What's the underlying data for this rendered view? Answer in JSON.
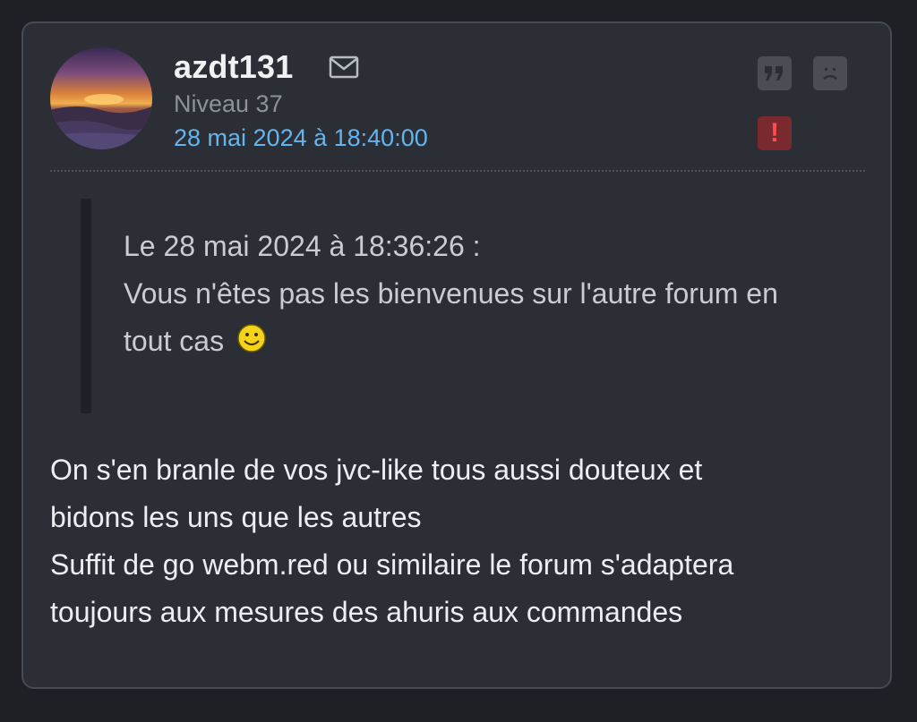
{
  "post": {
    "author": {
      "username": "azdt131",
      "level": "Niveau 37",
      "avatar_icon": "sunset-avatar"
    },
    "date": "28 mai 2024 à 18:40:00",
    "actions": {
      "quote_icon": "quote-icon",
      "sad_icon": "sad-face-icon",
      "report_symbol": "!"
    },
    "quote": {
      "header": "Le 28 mai 2024 à 18:36:26 :",
      "lines": [
        "Vous n'êtes pas les bienvenues sur l'autre forum en",
        "tout cas"
      ],
      "emoji": "smiley-icon"
    },
    "body_lines": [
      "On s'en branle de vos jvc-like tous aussi douteux et",
      "bidons les uns que les autres",
      "Suffit de go webm.red ou similaire le forum s'adaptera",
      "toujours aux mesures des ahuris aux commandes"
    ]
  },
  "colors": {
    "page_bg": "#1e2025",
    "card_bg": "#2b2e35",
    "date_link": "#64b4f0",
    "report_bg": "#7a2a2e",
    "report_fg": "#ff4d4d"
  }
}
